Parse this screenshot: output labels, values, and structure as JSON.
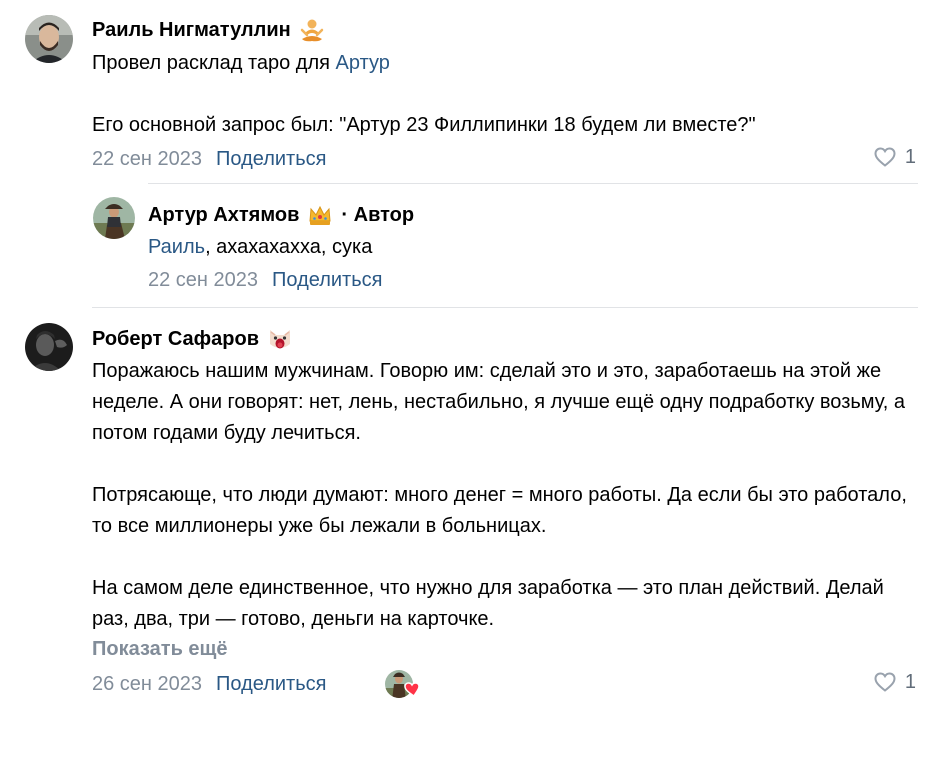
{
  "comments": [
    {
      "author": "Раиль Нигматуллин",
      "badge_icon": "meditation-emoji-icon",
      "mention": "Артур",
      "text_intro": "Провел расклад таро для ",
      "text_second": "Его основной запрос был: \"Артур 23 Филлипинки 18 будем ли вместе?\"",
      "date": "22 сен 2023",
      "share_label": "Поделиться",
      "likes": "1"
    },
    {
      "author": "Артур Ахтямов",
      "badge_icon": "crown-emoji-icon",
      "author_tag": "· Автор",
      "mention": "Раиль",
      "text_rest": ", ахахахахха, сука",
      "date": "22 сен 2023",
      "share_label": "Поделиться"
    },
    {
      "author": "Роберт Сафаров",
      "badge_icon": "screaming-cat-emoji-icon",
      "paragraphs": [
        "Поражаюсь нашим мужчинам. Говорю им: сделай это и это, заработаешь на этой же неделе. А они говорят: нет, лень, нестабильно, я лучше ещё одну подработку возьму, а потом годами буду лечиться.",
        "Потрясающе, что люди думают: много денег = много работы. Да если бы это работало, то все миллионеры уже бы лежали в больницах.",
        "На самом деле единственное, что нужно для заработка — это план действий. Делай раз, два, три — готово, деньги на карточке."
      ],
      "show_more_label": "Показать ещё",
      "date": "26 сен 2023",
      "share_label": "Поделиться",
      "likes": "1"
    }
  ],
  "colors": {
    "link": "#2a5885",
    "meta": "#818c99",
    "like_heart_red": "#ff3347"
  }
}
